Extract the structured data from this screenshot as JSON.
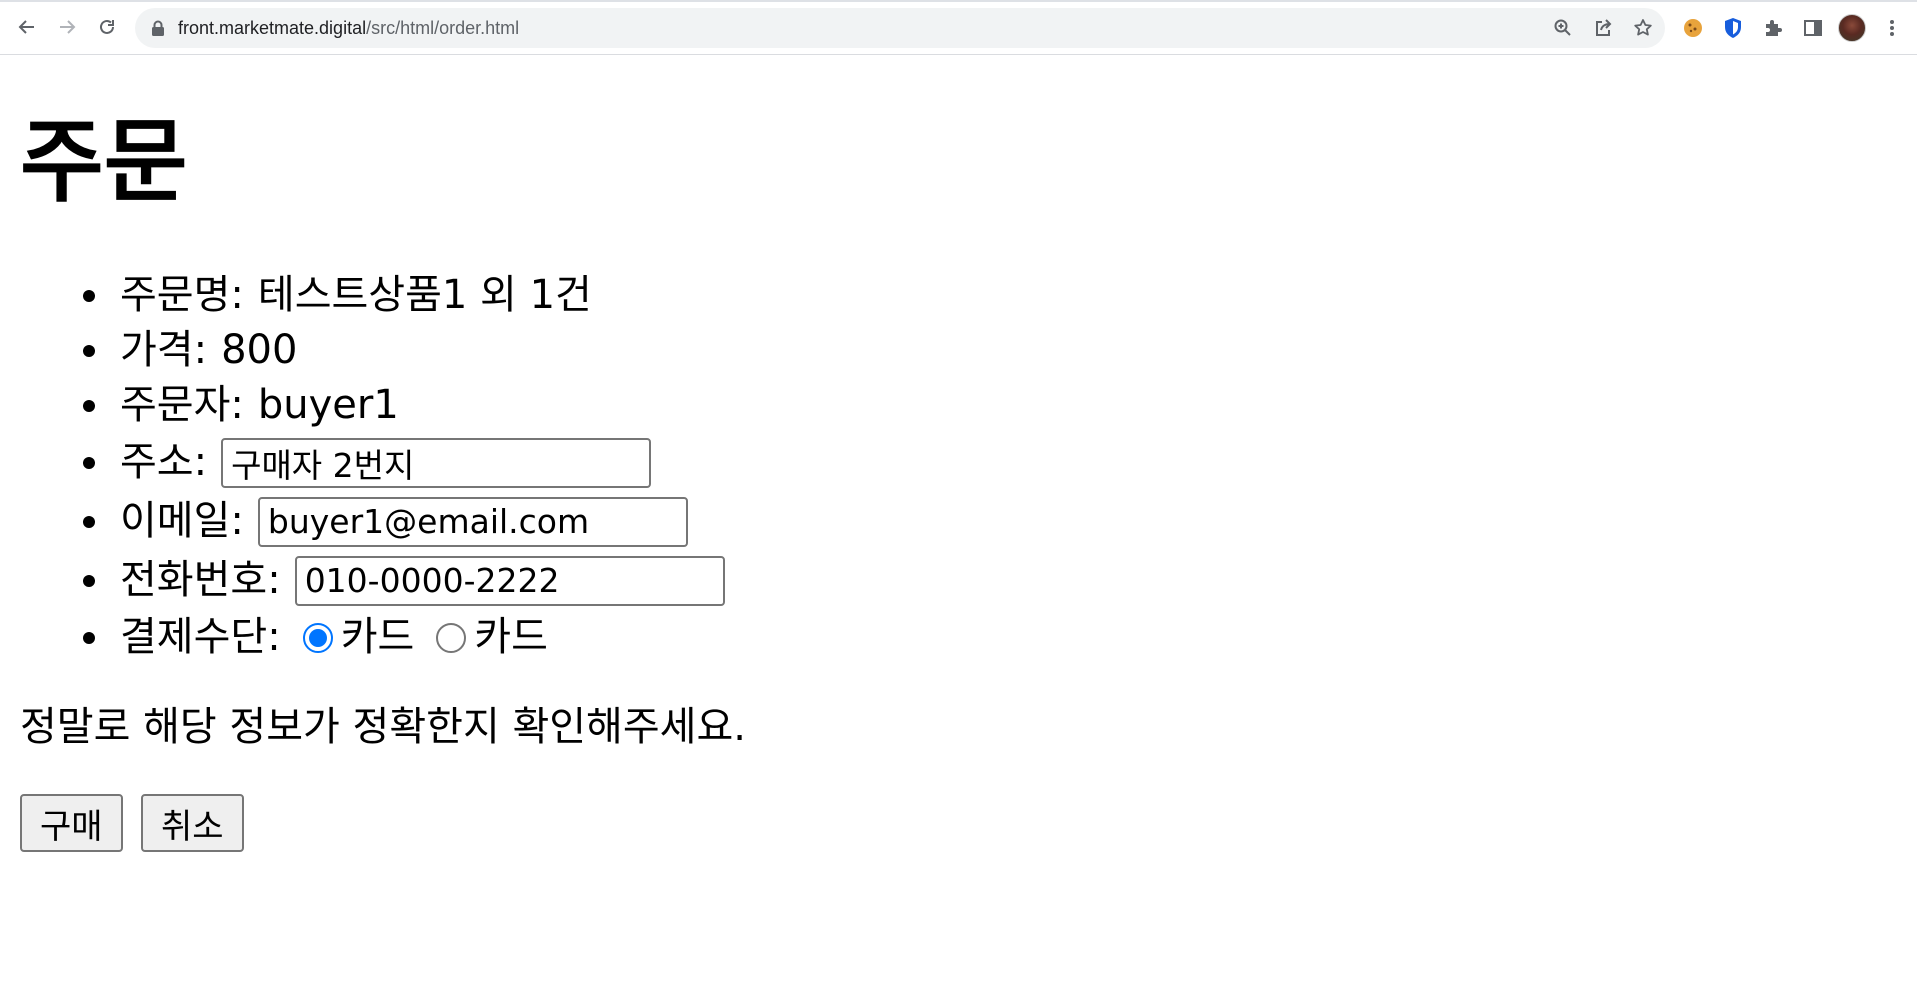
{
  "browser": {
    "url_host": "front.marketmate.digital",
    "url_path": "/src/html/order.html",
    "toolbar_icons": [
      "back-icon",
      "forward-icon",
      "reload-icon",
      "lock-icon",
      "zoom-icon",
      "share-icon",
      "bookmark-star-icon",
      "cookie-extension-icon",
      "shield-extension-icon",
      "puzzle-extensions-icon",
      "side-panel-icon",
      "profile-avatar",
      "menu-kebab-icon"
    ],
    "colors": {
      "accent": "#0075ff",
      "omnibox_bg": "#f1f3f4"
    }
  },
  "page": {
    "title": "주문",
    "order_name_label": "주문명:",
    "order_name_value": "테스트상품1 외 1건",
    "price_label": "가격:",
    "price_value": "800",
    "buyer_label": "주문자:",
    "buyer_value": "buyer1",
    "address_label": "주소:",
    "address_value": "구매자 2번지",
    "email_label": "이메일:",
    "email_value": "buyer1@email.com",
    "phone_label": "전화번호:",
    "phone_value": "010-0000-2222",
    "payment_label": "결제수단:",
    "payment_options": [
      {
        "label": "카드",
        "checked": true
      },
      {
        "label": "카드",
        "checked": false
      }
    ],
    "confirm_message": "정말로 해당 정보가 정확한지 확인해주세요.",
    "buy_button": "구매",
    "cancel_button": "취소"
  }
}
